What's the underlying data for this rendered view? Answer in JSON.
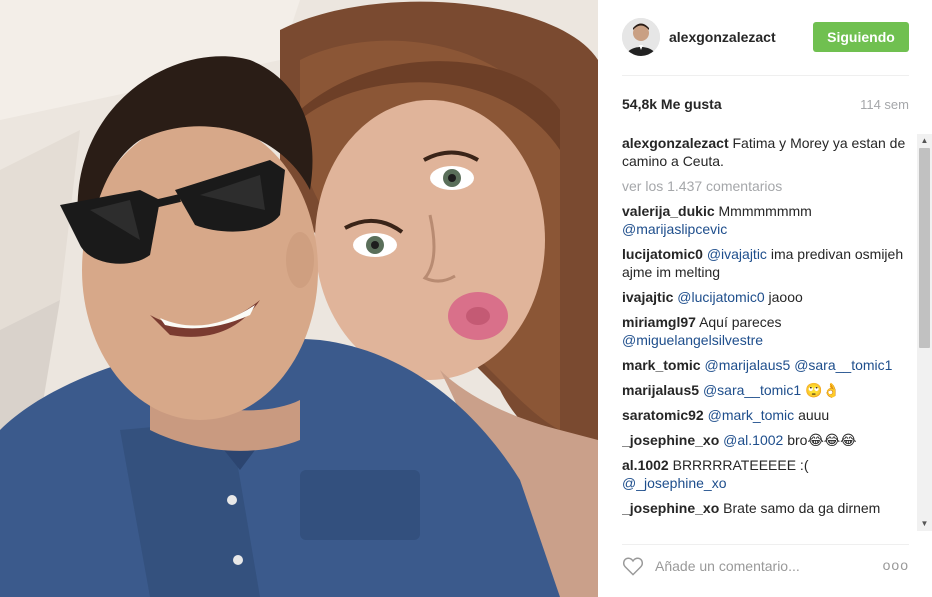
{
  "post": {
    "username": "alexgonzalezact",
    "follow_label": "Siguiendo",
    "likes": "54,8k Me gusta",
    "time_ago": "114 sem"
  },
  "caption": {
    "user": "alexgonzalezact",
    "text": "Fatima y Morey ya estan de camino a Ceuta."
  },
  "view_all_label": "ver los 1.437 comentarios",
  "comments": [
    {
      "user": "valerija_dukic",
      "text": "Mmmmmmmm",
      "mention": "@marijaslipcevic"
    },
    {
      "user": "lucijatomic0",
      "mention": "@ivajajtic",
      "text": "ima predivan osmijeh ajme im melting"
    },
    {
      "user": "ivajajtic",
      "mention": "@lucijatomic0",
      "text": "jaooo"
    },
    {
      "user": "miriamgl97",
      "text": "Aquí pareces",
      "mention": "@miguelangelsilvestre"
    },
    {
      "user": "mark_tomic",
      "mention": "@marijalaus5",
      "mention2": "@sara__tomic1"
    },
    {
      "user": "marijalaus5",
      "mention": "@sara__tomic1",
      "text": "🙄👌"
    },
    {
      "user": "saratomic92",
      "mention": "@mark_tomic",
      "text": "auuu"
    },
    {
      "user": "_josephine_xo",
      "mention": "@al.1002",
      "text": "bro😂😂😂"
    },
    {
      "user": "al.1002",
      "text": "BRRRRRATEEEEE :(",
      "mention": "@_josephine_xo"
    },
    {
      "user": "_josephine_xo",
      "text": "Brate samo da ga dirnem"
    }
  ],
  "footer": {
    "placeholder": "Añade un comentario...",
    "more": "ooo"
  },
  "icons": {
    "heart": "heart-icon",
    "more": "more-options-icon"
  },
  "colors": {
    "follow_button": "#70c050",
    "mention": "#1e4e8c",
    "muted": "#a5a7aa"
  }
}
